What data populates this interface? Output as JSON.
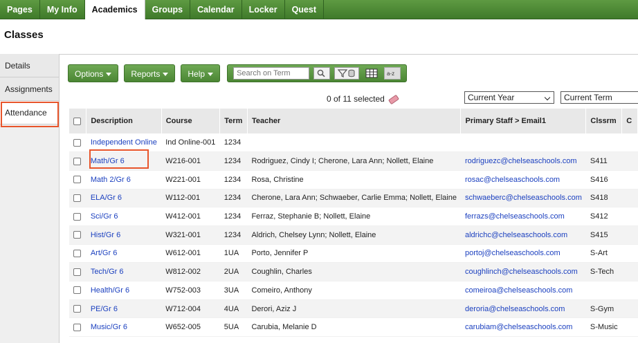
{
  "nav": {
    "tabs": [
      "Pages",
      "My Info",
      "Academics",
      "Groups",
      "Calendar",
      "Locker",
      "Quest"
    ],
    "active": "Academics"
  },
  "page_title": "Classes",
  "side_tabs": [
    "Details",
    "Assignments",
    "Attendance"
  ],
  "toolbar": {
    "options_label": "Options",
    "reports_label": "Reports",
    "help_label": "Help",
    "search_placeholder": "Search on Term"
  },
  "selection": {
    "text": "0 of 11 selected"
  },
  "filters": {
    "year": "Current Year",
    "term": "Current Term"
  },
  "table": {
    "headers": [
      "Description",
      "Course",
      "Term",
      "Teacher",
      "Primary Staff > Email1",
      "Clssrm",
      "C"
    ],
    "rows": [
      {
        "description": "Independent Online",
        "course": "Ind Online-001",
        "term": "1234",
        "teacher": "",
        "email": "",
        "room": ""
      },
      {
        "description": "Math/Gr 6",
        "course": "W216-001",
        "term": "1234",
        "teacher": "Rodriguez, Cindy I; Cherone, Lara Ann; Nollett, Elaine",
        "email": "rodriguezc@chelseaschools.com",
        "room": "S411"
      },
      {
        "description": "Math 2/Gr 6",
        "course": "W221-001",
        "term": "1234",
        "teacher": "Rosa, Christine",
        "email": "rosac@chelseaschools.com",
        "room": "S416"
      },
      {
        "description": "ELA/Gr 6",
        "course": "W112-001",
        "term": "1234",
        "teacher": "Cherone, Lara Ann; Schwaeber, Carlie Emma; Nollett, Elaine",
        "email": "schwaeberc@chelseaschools.com",
        "room": "S418"
      },
      {
        "description": "Sci/Gr 6",
        "course": "W412-001",
        "term": "1234",
        "teacher": "Ferraz, Stephanie B; Nollett, Elaine",
        "email": "ferrazs@chelseaschools.com",
        "room": "S412"
      },
      {
        "description": "Hist/Gr 6",
        "course": "W321-001",
        "term": "1234",
        "teacher": "Aldrich, Chelsey Lynn; Nollett, Elaine",
        "email": "aldrichc@chelseaschools.com",
        "room": "S415"
      },
      {
        "description": "Art/Gr 6",
        "course": "W612-001",
        "term": "1UA",
        "teacher": "Porto, Jennifer P",
        "email": "portoj@chelseaschools.com",
        "room": "S-Art"
      },
      {
        "description": "Tech/Gr 6",
        "course": "W812-002",
        "term": "2UA",
        "teacher": "Coughlin, Charles",
        "email": "coughlinch@chelseaschools.com",
        "room": "S-Tech"
      },
      {
        "description": "Health/Gr 6",
        "course": "W752-003",
        "term": "3UA",
        "teacher": "Comeiro, Anthony",
        "email": "comeiroa@chelseaschools.com",
        "room": ""
      },
      {
        "description": "PE/Gr 6",
        "course": "W712-004",
        "term": "4UA",
        "teacher": "Derori, Aziz J",
        "email": "deroria@chelseaschools.com",
        "room": "S-Gym"
      },
      {
        "description": "Music/Gr 6",
        "course": "W652-005",
        "term": "5UA",
        "teacher": "Carubia, Melanie D",
        "email": "carubiam@chelseaschools.com",
        "room": "S-Music"
      }
    ]
  },
  "colors": {
    "nav_green": "#4b8634",
    "highlight": "#e8552b",
    "link": "#1a3fbf"
  }
}
